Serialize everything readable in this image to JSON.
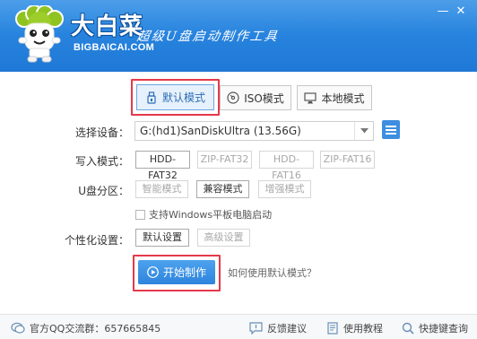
{
  "header": {
    "brand_name": "大白菜",
    "brand_url": "BIGBAICAI.COM",
    "slogan": "超级U盘启动制作工具",
    "minimize_glyph": "—",
    "close_glyph": "✕"
  },
  "tabs": [
    {
      "label": "默认模式",
      "icon": "usb-drive-icon",
      "active": true
    },
    {
      "label": "ISO模式",
      "icon": "disc-icon",
      "active": false
    },
    {
      "label": "本地模式",
      "icon": "monitor-icon",
      "active": false
    }
  ],
  "form": {
    "device_label": "选择设备：",
    "device_value": "G:(hd1)SanDiskUltra (13.56G)",
    "write_mode_label": "写入模式：",
    "write_modes": [
      "HDD-FAT32",
      "ZIP-FAT32",
      "HDD-FAT16",
      "ZIP-FAT16"
    ],
    "write_mode_selected": "HDD-FAT32",
    "partition_label": "U盘分区：",
    "partition_modes": [
      "智能模式",
      "兼容模式",
      "增强模式"
    ],
    "partition_selected": "兼容模式",
    "tablet_boot_label": "支持Windows平板电脑启动",
    "tablet_boot_checked": false,
    "personalize_label": "个性化设置：",
    "personalize_options": [
      "默认设置",
      "高级设置"
    ],
    "personalize_selected": "默认设置"
  },
  "actions": {
    "start_label": "开始制作",
    "help_link": "如何使用默认模式？"
  },
  "footer": {
    "qq_group": "官方QQ交流群：657665845",
    "feedback": "反馈建议",
    "tutorial": "使用教程",
    "shortcut": "快捷键查询"
  },
  "colors": {
    "header_blue": "#2584de",
    "accent_blue": "#3d8ee0",
    "highlight_red": "#e5394a",
    "mascot_green": "#8fc31f"
  }
}
